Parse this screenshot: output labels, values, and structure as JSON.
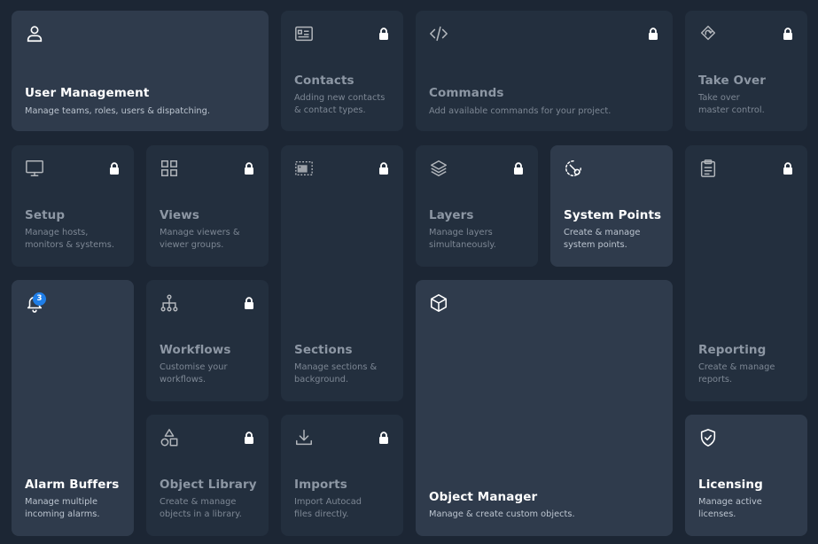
{
  "tiles": {
    "user_management": {
      "title": "User Management",
      "desc": "Manage teams, roles, users & dispatching."
    },
    "contacts": {
      "title": "Contacts",
      "desc": "Adding new contacts\n& contact types."
    },
    "commands": {
      "title": "Commands",
      "desc": "Add available commands for your project."
    },
    "take_over": {
      "title": "Take Over",
      "desc": "Take over\nmaster control."
    },
    "setup": {
      "title": "Setup",
      "desc": "Manage hosts,\nmonitors & systems."
    },
    "views": {
      "title": "Views",
      "desc": "Manage viewers &\nviewer groups."
    },
    "sections": {
      "title": "Sections",
      "desc": "Manage sections &\nbackground."
    },
    "layers": {
      "title": "Layers",
      "desc": "Manage layers\nsimultaneously."
    },
    "system_points": {
      "title": "System Points",
      "desc": "Create & manage\nsystem points."
    },
    "reporting": {
      "title": "Reporting",
      "desc": "Create & manage\nreports."
    },
    "alarm_buffers": {
      "title": "Alarm Buffers",
      "desc": "Manage multiple\nincoming alarms.",
      "badge": "3"
    },
    "workflows": {
      "title": "Workflows",
      "desc": "Customise your\nworkflows."
    },
    "object_manager": {
      "title": "Object Manager",
      "desc": "Manage & create custom objects."
    },
    "object_library": {
      "title": "Object Library",
      "desc": "Create & manage\nobjects in a library."
    },
    "imports": {
      "title": "Imports",
      "desc": "Import Autocad\nfiles directly."
    },
    "licensing": {
      "title": "Licensing",
      "desc": "Manage active\nlicenses."
    }
  },
  "icons": {
    "user_management": "user-icon",
    "contacts": "contact-card-icon",
    "commands": "code-icon",
    "take_over": "take-over-icon",
    "setup": "monitor-icon",
    "views": "grid-icon",
    "sections": "section-image-icon",
    "layers": "layers-icon",
    "system_points": "system-points-icon",
    "reporting": "clipboard-icon",
    "alarm_buffers": "bell-icon",
    "workflows": "hierarchy-icon",
    "object_manager": "cube-icon",
    "object_library": "shapes-icon",
    "imports": "download-icon",
    "licensing": "shield-check-icon",
    "lock": "lock-icon"
  },
  "colors": {
    "background": "#1c2634",
    "tile": "#2a3646",
    "tile_locked": "#232f3e",
    "badge": "#1f7ee8"
  }
}
